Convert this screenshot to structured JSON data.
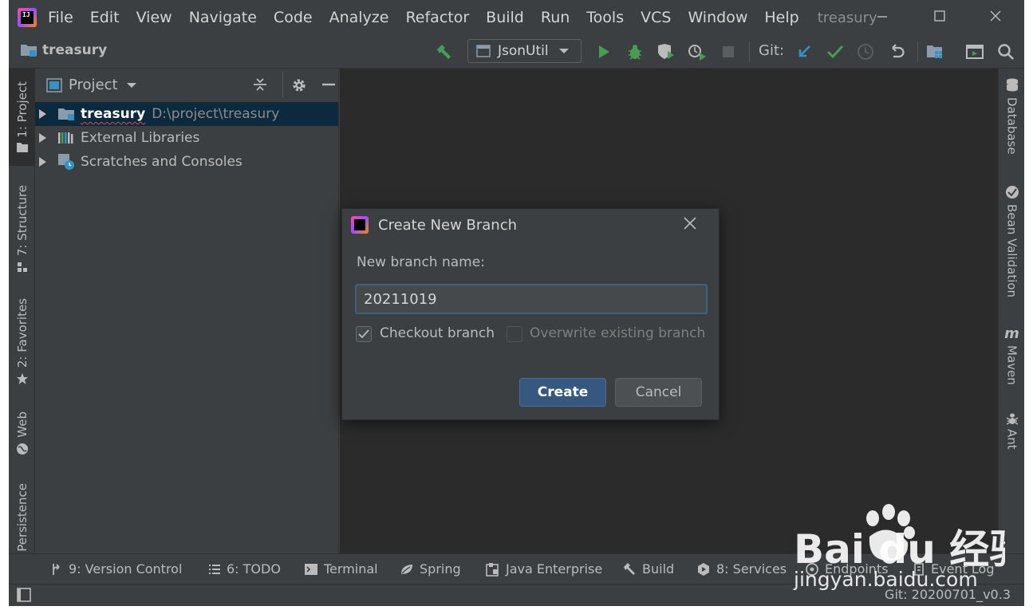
{
  "menubar": {
    "items": [
      "File",
      "Edit",
      "View",
      "Navigate",
      "Code",
      "Analyze",
      "Refactor",
      "Build",
      "Run",
      "Tools",
      "VCS",
      "Window",
      "Help"
    ],
    "project_title": "treasury"
  },
  "navbar": {
    "breadcrumb": "treasury",
    "run_config": "JsonUtil",
    "git_label": "Git:"
  },
  "left_tool_windows": [
    "1: Project",
    "7: Structure",
    "2: Favorites",
    "Web",
    "Persistence"
  ],
  "right_tool_windows": [
    "Database",
    "Bean Validation",
    "Maven",
    "Ant"
  ],
  "project_panel": {
    "title": "Project",
    "tree": [
      {
        "label": "treasury",
        "path": "D:\\project\\treasury",
        "selected": true
      },
      {
        "label": "External Libraries"
      },
      {
        "label": "Scratches and Consoles"
      }
    ]
  },
  "bottom_tool_windows": [
    "9: Version Control",
    "6: TODO",
    "Terminal",
    "Spring",
    "Java Enterprise",
    "Build",
    "8: Services",
    "Endpoints",
    "Event Log"
  ],
  "statusbar": {
    "git_branch": "Git: 20200701_v0.3"
  },
  "dialog": {
    "title": "Create New Branch",
    "field_label": "New branch name:",
    "branch_name": "20211019",
    "checkout": {
      "label": "Checkout branch",
      "checked": true
    },
    "overwrite": {
      "label": "Overwrite existing branch",
      "checked": false,
      "enabled": false
    },
    "create_button": "Create",
    "cancel_button": "Cancel"
  },
  "watermark": {
    "brand": "Bai du 经验",
    "url": "jingyan.baidu.com"
  },
  "colors": {
    "background": "#3c3f41",
    "editor": "#2b2b2b",
    "selection": "#0d293e",
    "primary_button": "#365880",
    "run_green": "#499c54",
    "git_blue": "#3592c4"
  }
}
